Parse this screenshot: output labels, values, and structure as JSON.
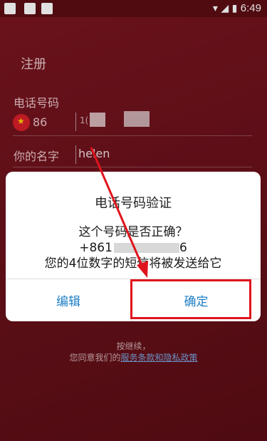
{
  "status_bar": {
    "time": "6:49"
  },
  "page": {
    "title": "注册",
    "phone_label": "电话号码",
    "country_code": "86",
    "phone_value": "1(",
    "name_label": "你的名字",
    "name_value": "helen",
    "continue_text": "按继续，",
    "agree_text": "您同意我们的",
    "agree_link": "服务条款和隐私政策"
  },
  "dialog": {
    "title": "电话号码验证",
    "question": "这个号码是否正确？",
    "number_prefix": "+861",
    "number_visible": "6",
    "info": "您的4位数字的短信将被发送给它",
    "edit_button": "编辑",
    "ok_button": "确定"
  },
  "colors": {
    "accent": "#1e7fc6",
    "annotation": "#e0141c",
    "background": "#6b111b"
  }
}
